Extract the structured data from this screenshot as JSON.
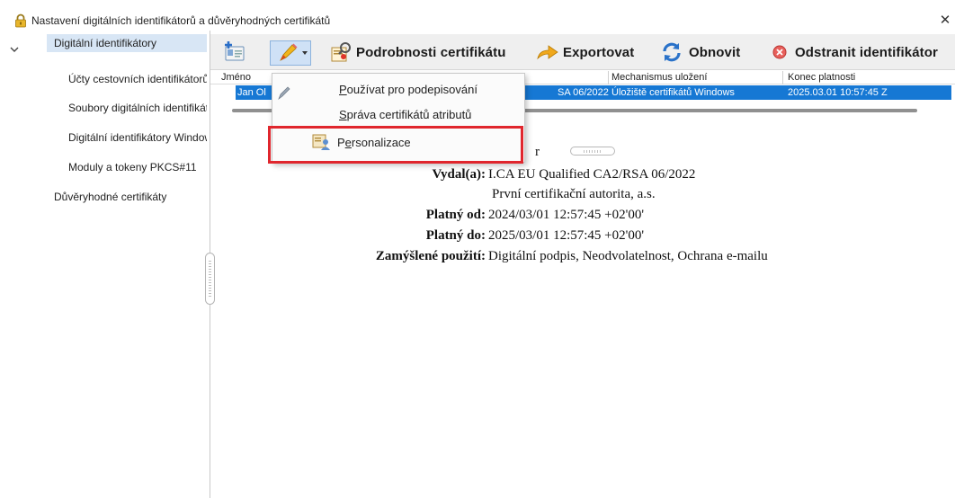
{
  "window": {
    "title": "Nastavení digitálních identifikátorů a důvěryhodných certifikátů",
    "close_glyph": "✕"
  },
  "sidebar": {
    "items": [
      {
        "label": "Digitální identifikátory",
        "selected": true
      },
      {
        "label": "Účty cestovních identifikátorů"
      },
      {
        "label": "Soubory digitálních identifikátorů"
      },
      {
        "label": "Digitální identifikátory Windows"
      },
      {
        "label": "Moduly a tokeny PKCS#11"
      },
      {
        "label": "Důvěryhodné certifikáty"
      }
    ]
  },
  "toolbar": {
    "add_icon": "add-id-icon",
    "pen_icon": "pen-icon",
    "details_label": "Podrobnosti certifikátu",
    "export_label": "Exportovat",
    "refresh_label": "Obnovit",
    "remove_label": "Odstranit identifikátor"
  },
  "table": {
    "columns": [
      "Jméno",
      "Mechanismus uložení",
      "Konec platnosti"
    ],
    "rows": [
      {
        "name": "Jan Ol",
        "issuer_fragment": "SA 06/2022",
        "storage": "Úložiště certifikátů Windows",
        "expires": "2025.03.01 10:57:45 Z"
      }
    ]
  },
  "details": {
    "top_fragment": "r",
    "issued_by_label": "Vydal(a):",
    "issued_by_value": "I.CA EU Qualified CA2/RSA 06/2022",
    "issued_by_org": "První certifikační autorita, a.s.",
    "valid_from_label": "Platný od:",
    "valid_from_value": "2024/03/01 12:57:45 +02'00'",
    "valid_to_label": "Platný do:",
    "valid_to_value": "2025/03/01 12:57:45 +02'00'",
    "usage_label": "Zamýšlené použití:",
    "usage_value": "Digitální podpis, Neodvolatelnost, Ochrana e-mailu"
  },
  "menu": {
    "item1_key": "P",
    "item1_rest": "oužívat pro podepisování",
    "item2_key": "S",
    "item2_rest": "práva certifikátů atributů",
    "item3_pre": "P",
    "item3_key": "e",
    "item3_rest": "rsonalizace"
  },
  "colors": {
    "selection": "#1678d4",
    "highlight": "#e0262d",
    "toolbar_bg": "#efefef"
  }
}
